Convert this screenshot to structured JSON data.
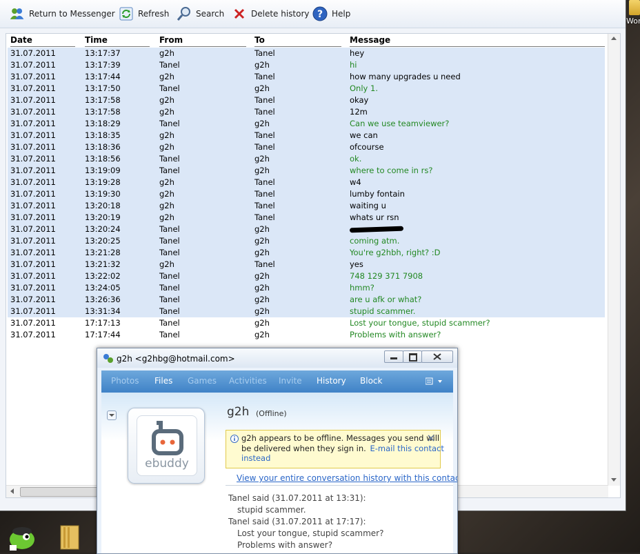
{
  "toolbar": {
    "return_label": "Return to Messenger",
    "refresh_label": "Refresh",
    "search_label": "Search",
    "delete_label": "Delete history",
    "help_label": "Help"
  },
  "desktop": {
    "corner_label": "Wor"
  },
  "table": {
    "headers": {
      "date": "Date",
      "time": "Time",
      "from": "From",
      "to": "To",
      "message": "Message"
    },
    "rows": [
      {
        "date": "31.07.2011",
        "time": "13:17:37",
        "from": "g2h",
        "to": "Tanel",
        "message": "hey"
      },
      {
        "date": "31.07.2011",
        "time": "13:17:39",
        "from": "Tanel",
        "to": "g2h",
        "message": "hi"
      },
      {
        "date": "31.07.2011",
        "time": "13:17:44",
        "from": "g2h",
        "to": "Tanel",
        "message": "how many upgrades u need"
      },
      {
        "date": "31.07.2011",
        "time": "13:17:50",
        "from": "Tanel",
        "to": "g2h",
        "message": "Only 1."
      },
      {
        "date": "31.07.2011",
        "time": "13:17:58",
        "from": "g2h",
        "to": "Tanel",
        "message": "okay"
      },
      {
        "date": "31.07.2011",
        "time": "13:17:58",
        "from": "g2h",
        "to": "Tanel",
        "message": "12m"
      },
      {
        "date": "31.07.2011",
        "time": "13:18:29",
        "from": "Tanel",
        "to": "g2h",
        "message": "Can we use teamviewer?"
      },
      {
        "date": "31.07.2011",
        "time": "13:18:35",
        "from": "g2h",
        "to": "Tanel",
        "message": "we can"
      },
      {
        "date": "31.07.2011",
        "time": "13:18:36",
        "from": "g2h",
        "to": "Tanel",
        "message": "ofcourse"
      },
      {
        "date": "31.07.2011",
        "time": "13:18:56",
        "from": "Tanel",
        "to": "g2h",
        "message": "ok."
      },
      {
        "date": "31.07.2011",
        "time": "13:19:09",
        "from": "Tanel",
        "to": "g2h",
        "message": "where to come in rs?"
      },
      {
        "date": "31.07.2011",
        "time": "13:19:28",
        "from": "g2h",
        "to": "Tanel",
        "message": "w4"
      },
      {
        "date": "31.07.2011",
        "time": "13:19:30",
        "from": "g2h",
        "to": "Tanel",
        "message": "lumby fontain"
      },
      {
        "date": "31.07.2011",
        "time": "13:20:18",
        "from": "g2h",
        "to": "Tanel",
        "message": "waiting u"
      },
      {
        "date": "31.07.2011",
        "time": "13:20:19",
        "from": "g2h",
        "to": "Tanel",
        "message": "whats ur rsn"
      },
      {
        "date": "31.07.2011",
        "time": "13:20:24",
        "from": "Tanel",
        "to": "g2h",
        "message": ""
      },
      {
        "date": "31.07.2011",
        "time": "13:20:25",
        "from": "Tanel",
        "to": "g2h",
        "message": "coming atm."
      },
      {
        "date": "31.07.2011",
        "time": "13:21:28",
        "from": "Tanel",
        "to": "g2h",
        "message": "You're g2hbh, right? :D"
      },
      {
        "date": "31.07.2011",
        "time": "13:21:32",
        "from": "g2h",
        "to": "Tanel",
        "message": "yes"
      },
      {
        "date": "31.07.2011",
        "time": "13:22:02",
        "from": "Tanel",
        "to": "g2h",
        "message": "748 129 371 7908"
      },
      {
        "date": "31.07.2011",
        "time": "13:24:05",
        "from": "Tanel",
        "to": "g2h",
        "message": "hmm?"
      },
      {
        "date": "31.07.2011",
        "time": "13:26:36",
        "from": "Tanel",
        "to": "g2h",
        "message": "are u afk or what?"
      },
      {
        "date": "31.07.2011",
        "time": "13:31:34",
        "from": "Tanel",
        "to": "g2h",
        "message": "stupid scammer."
      },
      {
        "date": "31.07.2011",
        "time": "17:17:13",
        "from": "Tanel",
        "to": "g2h",
        "message": "Lost your tongue, stupid scammer?"
      },
      {
        "date": "31.07.2011",
        "time": "17:17:44",
        "from": "Tanel",
        "to": "g2h",
        "message": "Problems with answer?"
      }
    ]
  },
  "chat": {
    "title": "g2h <g2hbg@hotmail.com>",
    "tabs": [
      "Photos",
      "Files",
      "Games",
      "Activities",
      "Invite",
      "History",
      "Block"
    ],
    "contact_name": "g2h",
    "contact_status": "(Offline)",
    "logo_text": "ebuddy",
    "offline_notice_1": "g2h appears to be offline. Messages you send will",
    "offline_notice_2": "be delivered when they sign in.",
    "email_link_1": "E-mail this contact",
    "email_link_2": "instead",
    "history_link": "View your entire conversation history with this contact",
    "messages": [
      {
        "header": "Tanel said (31.07.2011 at 13:31):",
        "lines": [
          "stupid scammer."
        ]
      },
      {
        "header": "Tanel said (31.07.2011 at 17:17):",
        "lines": [
          "Lost your tongue, stupid scammer?",
          "Problems with answer?"
        ]
      }
    ]
  }
}
